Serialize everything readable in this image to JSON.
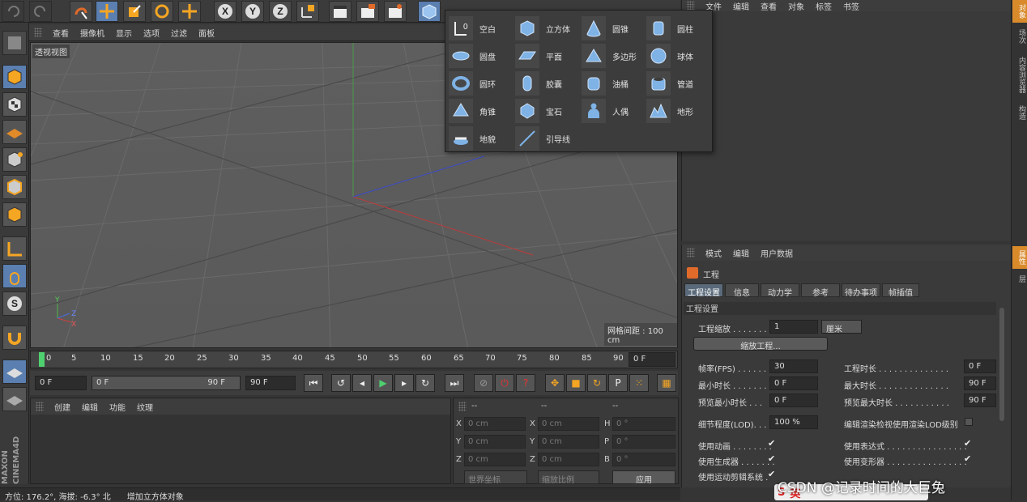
{
  "topbar": {
    "icons": [
      "undo-icon",
      "redo-icon",
      "live-select-icon",
      "move-icon",
      "scale-icon",
      "rotate-icon",
      "transform-icon",
      "x-axis-icon",
      "y-axis-icon",
      "z-axis-icon",
      "world-coord-icon",
      "render-view-icon",
      "render-pic-icon",
      "render-settings-icon",
      "cube-icon",
      "pen-icon",
      "subdivide-icon",
      "array-icon",
      "deformer-icon",
      "sky-icon",
      "light-icon"
    ]
  },
  "viewport_menu": {
    "items": [
      "查看",
      "摄像机",
      "显示",
      "选项",
      "过滤",
      "面板"
    ]
  },
  "viewport": {
    "label": "透视视图",
    "grid_spacing": "网格间距 : 100 cm",
    "axis_x": "X",
    "axis_y": "Y",
    "axis_z": "Z"
  },
  "timeline": {
    "ticks": [
      "0",
      "5",
      "10",
      "15",
      "20",
      "25",
      "30",
      "35",
      "40",
      "45",
      "50",
      "55",
      "60",
      "65",
      "70",
      "75",
      "80",
      "85",
      "90"
    ],
    "current": "0 F"
  },
  "transport": {
    "start": "0 F",
    "range_start": "0 F",
    "range_end": "90 F",
    "end": "90 F"
  },
  "material_menu": {
    "items": [
      "创建",
      "编辑",
      "功能",
      "纹理"
    ]
  },
  "coords": {
    "headers": [
      "--",
      "--",
      "--"
    ],
    "rows": [
      {
        "a": "X",
        "av": "0 cm",
        "b": "X",
        "bv": "0 cm",
        "c": "H",
        "cv": "0 °"
      },
      {
        "a": "Y",
        "av": "0 cm",
        "b": "Y",
        "bv": "0 cm",
        "c": "P",
        "cv": "0 °"
      },
      {
        "a": "Z",
        "av": "0 cm",
        "b": "Z",
        "bv": "0 cm",
        "c": "B",
        "cv": "0 °"
      }
    ],
    "world": "世界坐标",
    "scale": "缩放比例",
    "apply": "应用"
  },
  "status": {
    "left": "方位: 176.2°, 海拔: -6.3° 北",
    "right": "增加立方体对象"
  },
  "object_menu": {
    "items": [
      "文件",
      "编辑",
      "查看",
      "对象",
      "标签",
      "书签"
    ]
  },
  "right_tabs": [
    "对象",
    "场次",
    "内容浏览器",
    "构造",
    "属性",
    "层"
  ],
  "attr_menu": {
    "items": [
      "模式",
      "编辑",
      "用户数据"
    ]
  },
  "attr": {
    "title": "工程",
    "tabs": [
      "工程设置",
      "信息",
      "动力学",
      "参考",
      "待办事项",
      "帧插值"
    ],
    "section": "工程设置",
    "scale_label": "工程缩放 . . . . . . .",
    "scale_value": "1",
    "scale_unit": "厘米",
    "scale_button": "缩放工程...",
    "fps_label": "帧率(FPS) . . . . . .",
    "fps": "30",
    "duration_label": "工程时长 . . . . . . . . . . . . . .",
    "duration": "0 F",
    "min_label": "最小时长 . . . . . . .",
    "min": "0 F",
    "max_label": "最大时长 . . . . . . . . . . . . . .",
    "max": "90 F",
    "pmin_label": "预览最小时长 . . .",
    "pmin": "0 F",
    "pmax_label": "预览最大时长 . . . . . . . . . . .",
    "pmax": "90 F",
    "lod_label": "细节程度(LOD). . .",
    "lod": "100 %",
    "lod_render": "编辑渲染检视使用渲染LOD级别",
    "use_anim": "使用动画 . . . . . . . .",
    "use_expr": "使用表达式 . . . . . . . . . . . . . . . .",
    "use_gen": "使用生成器 . . . . . . .",
    "use_deform": "使用变形器 . . . . . . . . . . . . . . . .",
    "use_motion": "使用运动剪辑系统 ."
  },
  "dropdown": {
    "items": [
      {
        "label": "空白",
        "icon": "null-icon"
      },
      {
        "label": "圆盘",
        "icon": "disc-icon"
      },
      {
        "label": "圆环",
        "icon": "torus-icon"
      },
      {
        "label": "角锥",
        "icon": "pyramid-icon"
      },
      {
        "label": "地貌",
        "icon": "landscape-icon"
      },
      {
        "label": "立方体",
        "icon": "cube-icon"
      },
      {
        "label": "平面",
        "icon": "plane-icon"
      },
      {
        "label": "胶囊",
        "icon": "capsule-icon"
      },
      {
        "label": "宝石",
        "icon": "gem-icon"
      },
      {
        "label": "引导线",
        "icon": "guide-icon"
      },
      {
        "label": "圆锥",
        "icon": "cone-icon"
      },
      {
        "label": "多边形",
        "icon": "polygon-icon"
      },
      {
        "label": "油桶",
        "icon": "oil-tank-icon"
      },
      {
        "label": "人偶",
        "icon": "figure-icon"
      },
      {
        "label": "圆柱",
        "icon": "cylinder-icon"
      },
      {
        "label": "球体",
        "icon": "sphere-icon"
      },
      {
        "label": "管道",
        "icon": "tube-icon"
      },
      {
        "label": "地形",
        "icon": "terrain-icon"
      }
    ]
  },
  "watermark": "CSDN @记录时间的大巨兔",
  "ime_label": "英"
}
